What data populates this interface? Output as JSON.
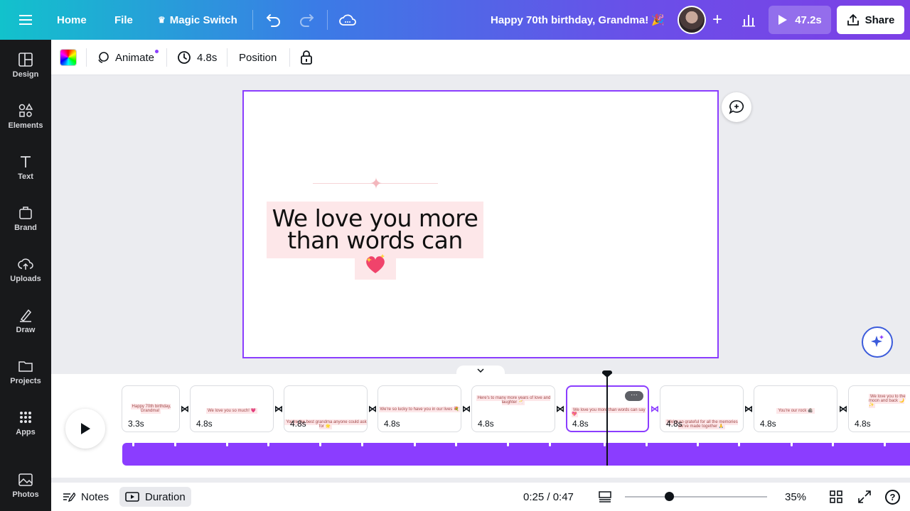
{
  "topbar": {
    "home": "Home",
    "file": "File",
    "magic_switch": "Magic Switch",
    "title": "Happy 70th birthday, Grandma! 🎉",
    "play_time": "47.2s",
    "share": "Share",
    "gradient_colors": [
      "#12c2cc",
      "#3b7be6",
      "#7d3fe6"
    ]
  },
  "sidebar": {
    "items": [
      {
        "label": "Design",
        "icon": "design-icon"
      },
      {
        "label": "Elements",
        "icon": "elements-icon"
      },
      {
        "label": "Text",
        "icon": "text-icon"
      },
      {
        "label": "Brand",
        "icon": "brand-icon"
      },
      {
        "label": "Uploads",
        "icon": "uploads-icon"
      },
      {
        "label": "Draw",
        "icon": "draw-icon"
      },
      {
        "label": "Projects",
        "icon": "projects-icon"
      },
      {
        "label": "Apps",
        "icon": "apps-icon"
      },
      {
        "label": "Photos",
        "icon": "photos-icon"
      }
    ]
  },
  "toolbar": {
    "animate": "Animate",
    "duration": "4.8s",
    "position": "Position"
  },
  "canvas": {
    "line1": "We love you more",
    "line2": "than words can say",
    "emoji": "💖",
    "accent": "#8b3dff",
    "highlight": "#fde7e9"
  },
  "timeline": {
    "pages": [
      {
        "duration": "3.3s",
        "text": "Happy 70th birthday, Grandma!"
      },
      {
        "duration": "4.8s",
        "text": "We love you so much! 💗"
      },
      {
        "duration": "4.8s",
        "text": "You're the best grandma anyone could ask for 🌟"
      },
      {
        "duration": "4.8s",
        "text": "We're so lucky to have you in our lives 💐"
      },
      {
        "duration": "4.8s",
        "text": "Here's to many more years of love and laughter 🥂"
      },
      {
        "duration": "4.8s",
        "text": "We love you more than words can say 💖"
      },
      {
        "duration": "4.8s",
        "text": "We're so grateful for all the memories we've made together 🙏"
      },
      {
        "duration": "4.8s",
        "text": "You're our rock 🪨"
      },
      {
        "duration": "4.8s",
        "text": "We love you to the moon and back 🌙✨"
      }
    ],
    "selected_index": 5,
    "selected_more": "···"
  },
  "bottom": {
    "notes": "Notes",
    "duration": "Duration",
    "time": "0:25 / 0:47",
    "zoom": "35%",
    "help": "?"
  }
}
